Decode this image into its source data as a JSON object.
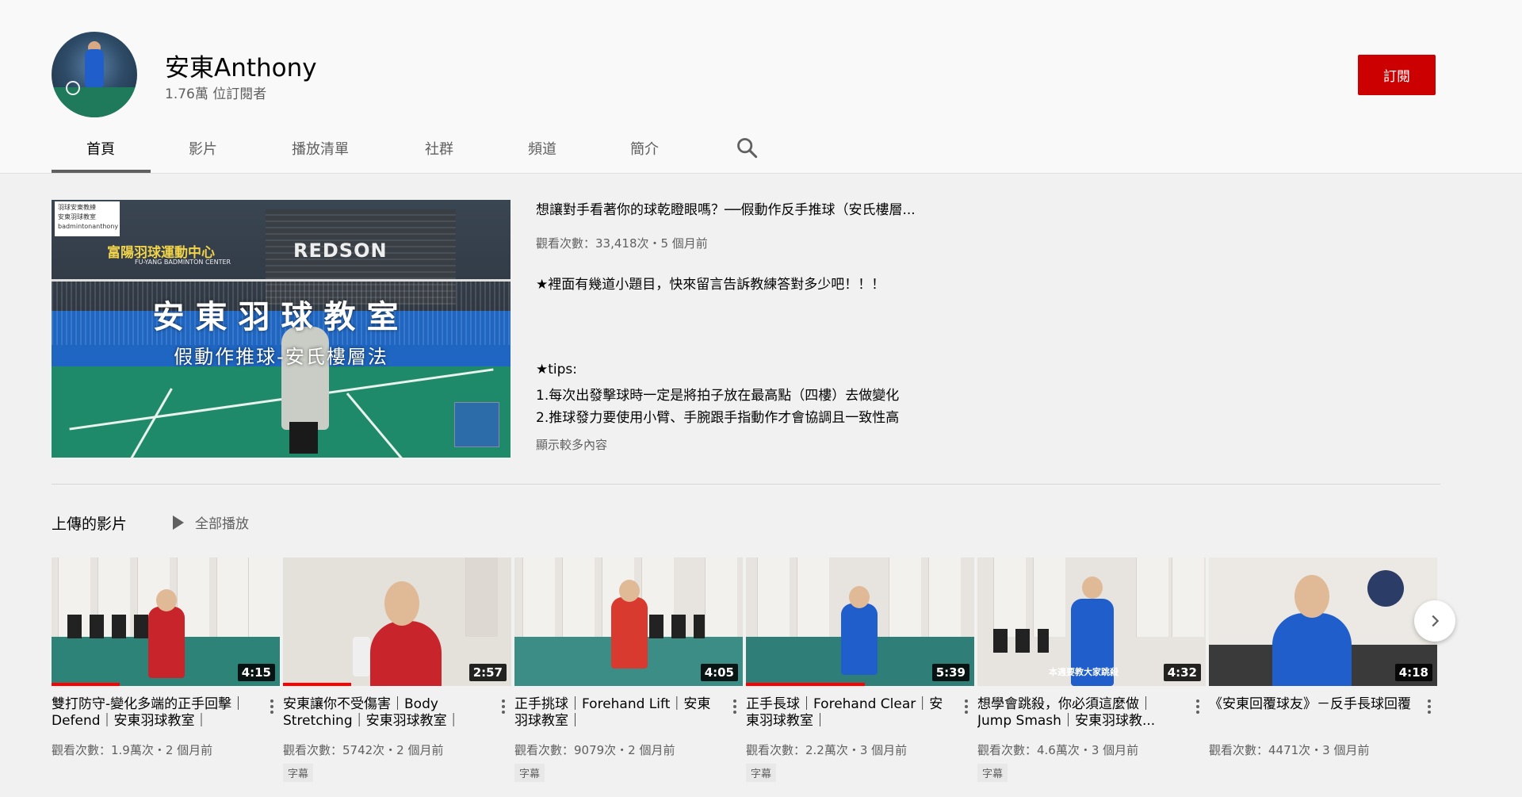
{
  "channel": {
    "name": "安東Anthony",
    "subscribers": "1.76萬 位訂閱者",
    "subscribe_label": "訂閱"
  },
  "tabs": [
    {
      "label": "首頁",
      "active": true
    },
    {
      "label": "影片"
    },
    {
      "label": "播放清單"
    },
    {
      "label": "社群"
    },
    {
      "label": "頻道"
    },
    {
      "label": "簡介"
    }
  ],
  "icons": {
    "search": "search-icon",
    "play": "play-icon",
    "next": "chevron-right-icon",
    "menu": "more-vert-icon"
  },
  "featured": {
    "title": "想讓對手看著你的球乾瞪眼嗎？──假動作反手推球（安氏樓層...",
    "meta": "觀看次數：33,418次・5 個月前",
    "description_lines": [
      "★裡面有幾道小題目，快來留言告訴教練答對多少吧！！！",
      "★tips:",
      "1.每次出發擊球時一定是將拍子放在最高點（四樓）去做變化",
      "2.推球發力要使用小臂、手腕跟手指動作才會協調且一致性高"
    ],
    "show_more": "顯示較多內容",
    "thumbnail": {
      "overlay_title": "安東羽球教室",
      "overlay_subtitle": "假動作推球-安氏樓層法",
      "logo_lines": [
        "羽球安東教練",
        "安東羽球教室",
        "badmintonanthony"
      ],
      "center_name": "富陽羽球運動中心",
      "center_sub": "FU-YANG BADMINTON CENTER",
      "brand": "REDSON"
    }
  },
  "uploads": {
    "title": "上傳的影片",
    "play_all": "全部播放",
    "videos": [
      {
        "title": "雙打防守-變化多端的正手回擊｜Defend｜安東羽球教室｜",
        "duration": "4:15",
        "meta": "觀看次數：1.9萬次・2 個月前",
        "badge": "",
        "progress": 0.3
      },
      {
        "title": "安東讓你不受傷害｜Body Stretching｜安東羽球教室｜",
        "duration": "2:57",
        "meta": "觀看次數：5742次・2 個月前",
        "badge": "字幕",
        "progress": 0.3
      },
      {
        "title": "正手挑球｜Forehand Lift｜安東羽球教室｜",
        "duration": "4:05",
        "meta": "觀看次數：9079次・2 個月前",
        "badge": "字幕",
        "progress": 0
      },
      {
        "title": "正手長球｜Forehand Clear｜安東羽球教室｜",
        "duration": "5:39",
        "meta": "觀看次數：2.2萬次・3 個月前",
        "badge": "字幕",
        "progress": 0.52
      },
      {
        "title": "想學會跳殺，你必須這麼做｜Jump Smash｜安東羽球教...",
        "duration": "4:32",
        "meta": "觀看次數：4.6萬次・3 個月前",
        "badge": "字幕",
        "progress": 0,
        "overlay": "本週要教大家跳殺"
      },
      {
        "title": "《安東回覆球友》－反手長球回覆",
        "duration": "4:18",
        "meta": "觀看次數：4471次・3 個月前",
        "badge": "",
        "progress": 0
      }
    ]
  }
}
